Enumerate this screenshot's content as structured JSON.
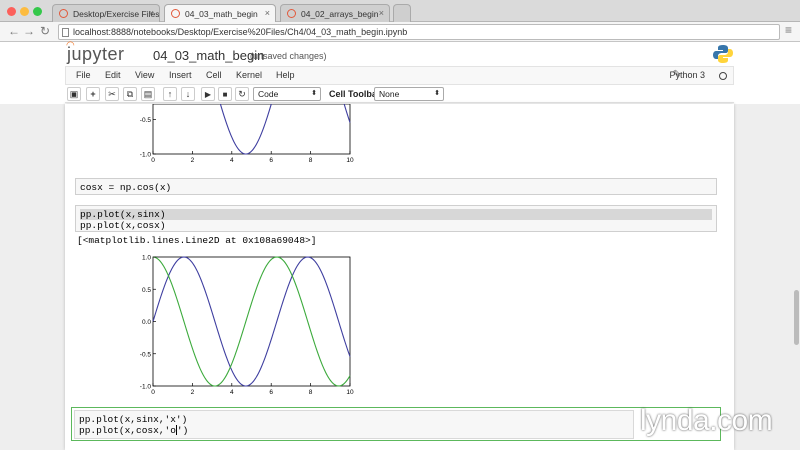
{
  "browser": {
    "tabs": [
      {
        "title": "Desktop/Exercise Files/Ch"
      },
      {
        "title": "04_03_math_begin"
      },
      {
        "title": "04_02_arrays_begin"
      }
    ],
    "url": "localhost:8888/notebooks/Desktop/Exercise%20Files/Ch4/04_03_math_begin.ipynb"
  },
  "jupyter": {
    "logo": "jupyter",
    "notebook_name": "04_03_math_begin",
    "save_status": "(unsaved changes)",
    "kernel_name": "Python 3",
    "menu": [
      "File",
      "Edit",
      "View",
      "Insert",
      "Cell",
      "Kernel",
      "Help"
    ],
    "toolbar": {
      "cell_type": "Code",
      "cell_toolbar_label": "Cell Toolbar:",
      "cell_toolbar_value": "None"
    }
  },
  "cells": {
    "c1": "cosx = np.cos(x)",
    "c2_line1": "pp.plot(x,sinx)",
    "c2_line2": "pp.plot(x,cosx)",
    "c2_output": "[<matplotlib.lines.Line2D at 0x108a69048>]",
    "c3_line1": "pp.plot(x,sinx,'x')",
    "c3_line2a": "pp.plot(x,cosx,'o",
    "c3_line2b": "')"
  },
  "watermark": "lynda.com",
  "colors": {
    "sin": "#3f3fa0",
    "cos": "#3caa3c",
    "active_border": "#5cb85c",
    "jupyter_orange": "#f37726"
  },
  "chart_data": [
    {
      "type": "line",
      "x_ticks": [
        "0",
        "2",
        "4",
        "6",
        "8",
        "10"
      ],
      "y_ticks": [
        "-0.5",
        "-1.0"
      ],
      "xlim": [
        0,
        10
      ],
      "series": [
        {
          "function": "sin(x)",
          "color": "#3f3fa0"
        }
      ],
      "partial": true
    },
    {
      "type": "line",
      "x_ticks": [
        "0",
        "2",
        "4",
        "6",
        "8",
        "10"
      ],
      "y_ticks": [
        "1.0",
        "0.5",
        "0.0",
        "-0.5",
        "-1.0"
      ],
      "xlim": [
        0,
        10
      ],
      "ylim": [
        -1,
        1
      ],
      "series": [
        {
          "function": "sin(x)",
          "color": "#3f3fa0"
        },
        {
          "function": "cos(x)",
          "color": "#3caa3c"
        }
      ]
    }
  ]
}
